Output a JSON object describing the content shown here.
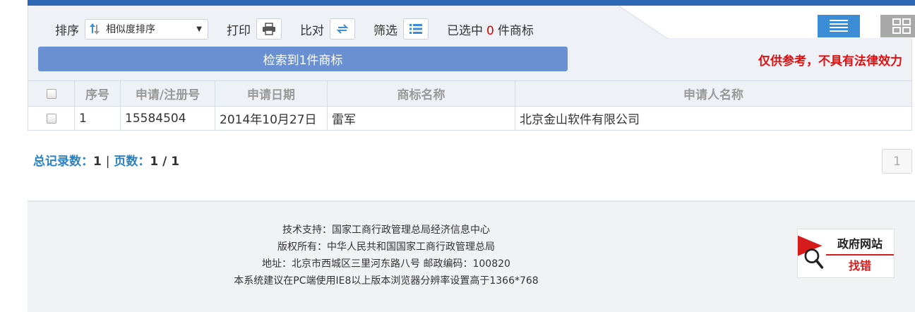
{
  "toolbar": {
    "sort_label": "排序",
    "sort_select_value": "相似度排序",
    "print_label": "打印",
    "compare_label": "比对",
    "filter_label": "筛选",
    "selected_prefix": "已选中",
    "selected_count": "0",
    "selected_suffix": "件商标"
  },
  "result_banner": "检索到1件商标",
  "disclaimer": "仅供参考，不具有法律效力",
  "table": {
    "headers": [
      "序号",
      "申请/注册号",
      "申请日期",
      "商标名称",
      "申请人名称"
    ],
    "rows": [
      {
        "index": "1",
        "reg_no": "15584504",
        "date": "2014年10月27日",
        "name": "雷军",
        "applicant": "北京金山软件有限公司"
      }
    ]
  },
  "pager": {
    "total_label": "总记录数：",
    "total_value": "1",
    "separator": "|",
    "pages_label": "页数：",
    "pages_value": "1 / 1",
    "current_page": "1"
  },
  "footer": {
    "lines": [
      "技术支持：国家工商行政管理总局经济信息中心",
      "版权所有：中华人民共和国国家工商行政管理总局",
      "地址：北京市西城区三里河东路八号  邮政编码：100820",
      "本系统建议在PC端使用IE8以上版本浏览器分辨率设置高于1366*768"
    ],
    "badge_line1": "政府网站",
    "badge_line2": "找错"
  },
  "colors": {
    "accent_blue": "#3b8ed6",
    "banner_blue": "#6a90d2",
    "link_blue": "#2a82c4",
    "alert_red": "#e01010"
  }
}
